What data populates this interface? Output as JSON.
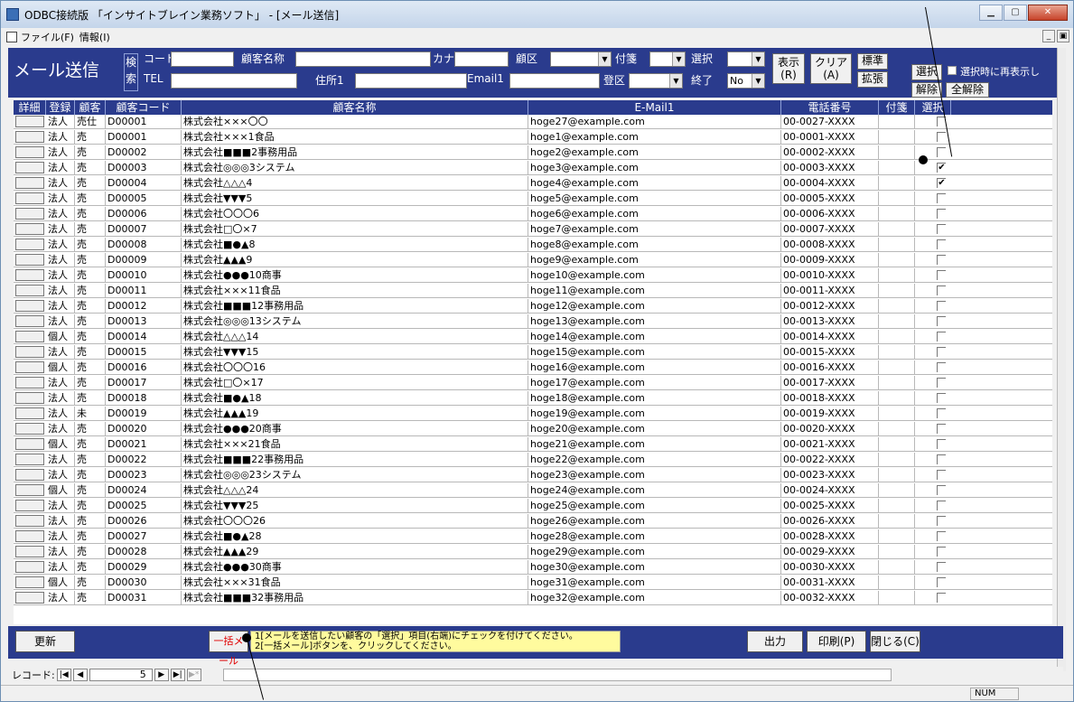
{
  "window": {
    "title": "ODBC接続版 「インサイトブレイン業務ソフト」 - [メール送信]"
  },
  "menu": {
    "file": "ファイル(F)",
    "info": "情報(I)"
  },
  "form": {
    "title": "メール送信",
    "search_label": "検索",
    "labels": {
      "code": "コード",
      "tel": "TEL",
      "name": "顧客名称",
      "address": "住所1",
      "kana": "カナ",
      "email": "Email1",
      "area": "顧区",
      "reg_area": "登区",
      "tag": "付箋",
      "select": "選択",
      "end": "終了"
    },
    "end_value": "No",
    "buttons": {
      "show": "表示\n(R)",
      "clear": "クリア\n(A)",
      "standard": "標準",
      "extend": "拡張",
      "select": "選択",
      "deselect": "解除",
      "deselect_all": "全解除",
      "redisplay": "選択時に再表示し"
    }
  },
  "columns": [
    "詳細",
    "登録",
    "顧客",
    "顧客コード",
    "顧客名称",
    "E-Mail1",
    "電話番号",
    "付箋",
    "選択"
  ],
  "rows": [
    {
      "type": "法人",
      "reg": "売仕",
      "code": "D00001",
      "name": "株式会社×××〇〇",
      "email": "hoge27@example.com",
      "tel": "00-0027-XXXX",
      "checked": false
    },
    {
      "type": "法人",
      "reg": "売",
      "code": "D00001",
      "name": "株式会社×××1食品",
      "email": "hoge1@example.com",
      "tel": "00-0001-XXXX",
      "checked": false
    },
    {
      "type": "法人",
      "reg": "売",
      "code": "D00002",
      "name": "株式会社■■■2事務用品",
      "email": "hoge2@example.com",
      "tel": "00-0002-XXXX",
      "checked": false
    },
    {
      "type": "法人",
      "reg": "売",
      "code": "D00003",
      "name": "株式会社◎◎◎3システム",
      "email": "hoge3@example.com",
      "tel": "00-0003-XXXX",
      "checked": true
    },
    {
      "type": "法人",
      "reg": "売",
      "code": "D00004",
      "name": "株式会社△△△4",
      "email": "hoge4@example.com",
      "tel": "00-0004-XXXX",
      "checked": true
    },
    {
      "type": "法人",
      "reg": "売",
      "code": "D00005",
      "name": "株式会社▼▼▼5",
      "email": "hoge5@example.com",
      "tel": "00-0005-XXXX",
      "checked": false
    },
    {
      "type": "法人",
      "reg": "売",
      "code": "D00006",
      "name": "株式会社〇〇〇6",
      "email": "hoge6@example.com",
      "tel": "00-0006-XXXX",
      "checked": false
    },
    {
      "type": "法人",
      "reg": "売",
      "code": "D00007",
      "name": "株式会社□〇×7",
      "email": "hoge7@example.com",
      "tel": "00-0007-XXXX",
      "checked": false
    },
    {
      "type": "法人",
      "reg": "売",
      "code": "D00008",
      "name": "株式会社■●▲8",
      "email": "hoge8@example.com",
      "tel": "00-0008-XXXX",
      "checked": false
    },
    {
      "type": "法人",
      "reg": "売",
      "code": "D00009",
      "name": "株式会社▲▲▲9",
      "email": "hoge9@example.com",
      "tel": "00-0009-XXXX",
      "checked": false
    },
    {
      "type": "法人",
      "reg": "売",
      "code": "D00010",
      "name": "株式会社●●●10商事",
      "email": "hoge10@example.com",
      "tel": "00-0010-XXXX",
      "checked": false
    },
    {
      "type": "法人",
      "reg": "売",
      "code": "D00011",
      "name": "株式会社×××11食品",
      "email": "hoge11@example.com",
      "tel": "00-0011-XXXX",
      "checked": false
    },
    {
      "type": "法人",
      "reg": "売",
      "code": "D00012",
      "name": "株式会社■■■12事務用品",
      "email": "hoge12@example.com",
      "tel": "00-0012-XXXX",
      "checked": false
    },
    {
      "type": "法人",
      "reg": "売",
      "code": "D00013",
      "name": "株式会社◎◎◎13システム",
      "email": "hoge13@example.com",
      "tel": "00-0013-XXXX",
      "checked": false
    },
    {
      "type": "個人",
      "reg": "売",
      "code": "D00014",
      "name": "株式会社△△△14",
      "email": "hoge14@example.com",
      "tel": "00-0014-XXXX",
      "checked": false
    },
    {
      "type": "法人",
      "reg": "売",
      "code": "D00015",
      "name": "株式会社▼▼▼15",
      "email": "hoge15@example.com",
      "tel": "00-0015-XXXX",
      "checked": false
    },
    {
      "type": "個人",
      "reg": "売",
      "code": "D00016",
      "name": "株式会社〇〇〇16",
      "email": "hoge16@example.com",
      "tel": "00-0016-XXXX",
      "checked": false
    },
    {
      "type": "法人",
      "reg": "売",
      "code": "D00017",
      "name": "株式会社□〇×17",
      "email": "hoge17@example.com",
      "tel": "00-0017-XXXX",
      "checked": false
    },
    {
      "type": "法人",
      "reg": "売",
      "code": "D00018",
      "name": "株式会社■●▲18",
      "email": "hoge18@example.com",
      "tel": "00-0018-XXXX",
      "checked": false
    },
    {
      "type": "法人",
      "reg": "未",
      "code": "D00019",
      "name": "株式会社▲▲▲19",
      "email": "hoge19@example.com",
      "tel": "00-0019-XXXX",
      "checked": false
    },
    {
      "type": "法人",
      "reg": "売",
      "code": "D00020",
      "name": "株式会社●●●20商事",
      "email": "hoge20@example.com",
      "tel": "00-0020-XXXX",
      "checked": false
    },
    {
      "type": "個人",
      "reg": "売",
      "code": "D00021",
      "name": "株式会社×××21食品",
      "email": "hoge21@example.com",
      "tel": "00-0021-XXXX",
      "checked": false
    },
    {
      "type": "法人",
      "reg": "売",
      "code": "D00022",
      "name": "株式会社■■■22事務用品",
      "email": "hoge22@example.com",
      "tel": "00-0022-XXXX",
      "checked": false
    },
    {
      "type": "法人",
      "reg": "売",
      "code": "D00023",
      "name": "株式会社◎◎◎23システム",
      "email": "hoge23@example.com",
      "tel": "00-0023-XXXX",
      "checked": false
    },
    {
      "type": "個人",
      "reg": "売",
      "code": "D00024",
      "name": "株式会社△△△24",
      "email": "hoge24@example.com",
      "tel": "00-0024-XXXX",
      "checked": false
    },
    {
      "type": "法人",
      "reg": "売",
      "code": "D00025",
      "name": "株式会社▼▼▼25",
      "email": "hoge25@example.com",
      "tel": "00-0025-XXXX",
      "checked": false
    },
    {
      "type": "法人",
      "reg": "売",
      "code": "D00026",
      "name": "株式会社〇〇〇26",
      "email": "hoge26@example.com",
      "tel": "00-0026-XXXX",
      "checked": false
    },
    {
      "type": "法人",
      "reg": "売",
      "code": "D00027",
      "name": "株式会社■●▲28",
      "email": "hoge28@example.com",
      "tel": "00-0028-XXXX",
      "checked": false
    },
    {
      "type": "法人",
      "reg": "売",
      "code": "D00028",
      "name": "株式会社▲▲▲29",
      "email": "hoge29@example.com",
      "tel": "00-0029-XXXX",
      "checked": false
    },
    {
      "type": "法人",
      "reg": "売",
      "code": "D00029",
      "name": "株式会社●●●30商事",
      "email": "hoge30@example.com",
      "tel": "00-0030-XXXX",
      "checked": false
    },
    {
      "type": "個人",
      "reg": "売",
      "code": "D00030",
      "name": "株式会社×××31食品",
      "email": "hoge31@example.com",
      "tel": "00-0031-XXXX",
      "checked": false
    },
    {
      "type": "法人",
      "reg": "売",
      "code": "D00031",
      "name": "株式会社■■■32事務用品",
      "email": "hoge32@example.com",
      "tel": "00-0032-XXXX",
      "checked": false
    }
  ],
  "footer": {
    "update": "更新",
    "bulk_mail": "一括メール",
    "note_line1": "1[メールを送信したい顧客の「選択」項目(右端)にチェックを付けてください。",
    "note_line2": "2[一括メール]ボタンを、クリックしてください。",
    "output": "出力",
    "print": "印刷(P)",
    "close": "閉じる(C)"
  },
  "recnav": {
    "label": "レコード:",
    "current": "5"
  },
  "status": {
    "num": "NUM"
  }
}
